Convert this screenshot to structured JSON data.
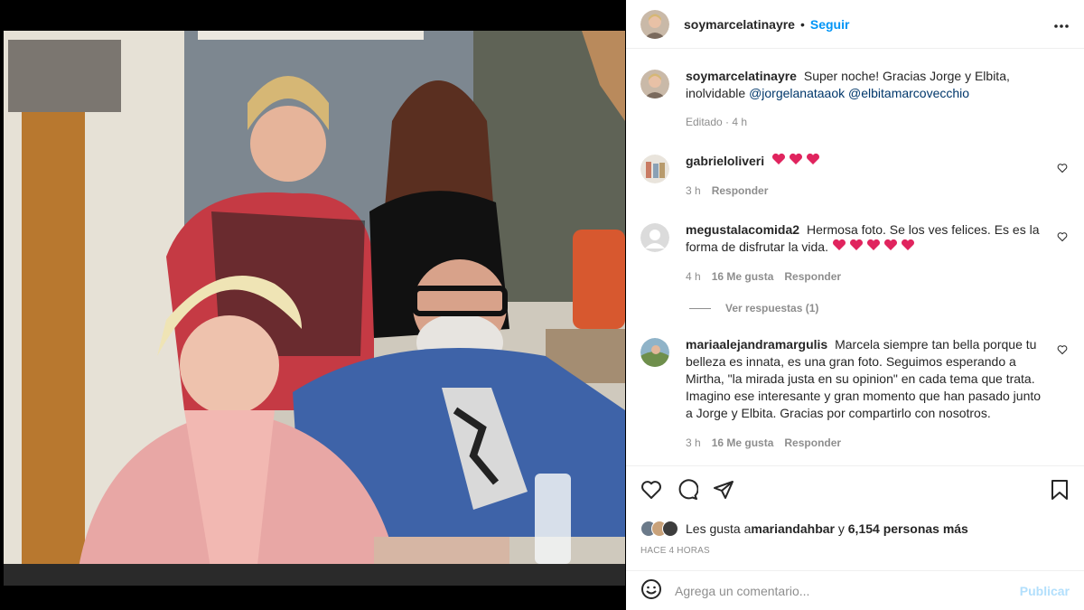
{
  "post": {
    "author": "soymarcelatinayre",
    "dot": "•",
    "follow_label": "Seguir",
    "more_label": "···"
  },
  "caption": {
    "username": "soymarcelatinayre",
    "text": "Super noche! Gracias Jorge y Elbita, inolvidable ",
    "mention1": "@jorgelanataaok",
    "mention2": "@elbitamarcovecchio",
    "edited": "Editado · 4 h"
  },
  "comments": [
    {
      "username": "gabrieloliveri",
      "text": "",
      "hearts": 3,
      "time": "3 h",
      "likes": "",
      "reply_label": "Responder"
    },
    {
      "username": "megustalacomida2",
      "text": "Hermosa foto. Se los ves felices. Es es la forma de disfrutar la vida. ",
      "hearts": 5,
      "time": "4 h",
      "likes": "16 Me gusta",
      "reply_label": "Responder",
      "view_replies": "Ver respuestas (1)"
    },
    {
      "username": "mariaalejandramargulis",
      "text": "Marcela siempre tan bella porque tu belleza es innata, es una gran foto. Seguimos esperando a Mirtha, \"la mirada justa en su opinion\" en cada tema que trata. Imagino ese interesante y gran momento que han pasado junto a Jorge y Elbita. Gracias por compartirlo con nosotros.",
      "hearts": 0,
      "time": "3 h",
      "likes": "16 Me gusta",
      "reply_label": "Responder"
    }
  ],
  "likes": {
    "prefix": "Les gusta a ",
    "user": "mariandahbar",
    "mid": " y ",
    "others": "6,154 personas más"
  },
  "timestamp": "HACE 4 HORAS",
  "add_comment": {
    "placeholder": "Agrega un comentario...",
    "publish_label": "Publicar"
  },
  "icons": {
    "like": "heart-icon",
    "comment": "comment-icon",
    "share": "share-icon",
    "save": "bookmark-icon",
    "emoji": "emoji-icon"
  },
  "colors": {
    "link": "#0095f6",
    "mention": "#00376b",
    "heart": "#e0245e",
    "muted": "#8e8e8e"
  }
}
